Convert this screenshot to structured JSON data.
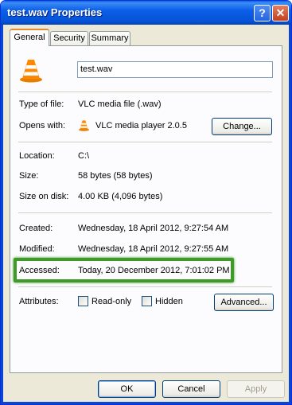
{
  "window": {
    "title": "test.wav Properties"
  },
  "titlebar_buttons": {
    "help": "?",
    "close": "✕"
  },
  "tabs": [
    {
      "label": "General",
      "active": true
    },
    {
      "label": "Security",
      "active": false
    },
    {
      "label": "Summary",
      "active": false
    }
  ],
  "file": {
    "name": "test.wav",
    "icon": "vlc-cone-icon"
  },
  "fields": {
    "type_label": "Type of file:",
    "type_value": "VLC media file (.wav)",
    "opens_label": "Opens with:",
    "opens_value": "VLC media player 2.0.5",
    "change_button": "Change...",
    "location_label": "Location:",
    "location_value": "C:\\",
    "size_label": "Size:",
    "size_value": "58 bytes (58 bytes)",
    "size_disk_label": "Size on disk:",
    "size_disk_value": "4.00 KB (4,096 bytes)",
    "created_label": "Created:",
    "created_value": "Wednesday, 18 April 2012, 9:27:54 AM",
    "modified_label": "Modified:",
    "modified_value": "Wednesday, 18 April 2012, 9:27:55 AM",
    "accessed_label": "Accessed:",
    "accessed_value": "Today, 20 December 2012, 7:01:02 PM",
    "attributes_label": "Attributes:",
    "readonly_label": "Read-only",
    "hidden_label": "Hidden",
    "advanced_button": "Advanced..."
  },
  "footer": {
    "ok": "OK",
    "cancel": "Cancel",
    "apply": "Apply"
  },
  "colors": {
    "highlight": "#3f9a2a",
    "titlebar": "#0552d6",
    "accent_tab": "#e68b2c"
  }
}
